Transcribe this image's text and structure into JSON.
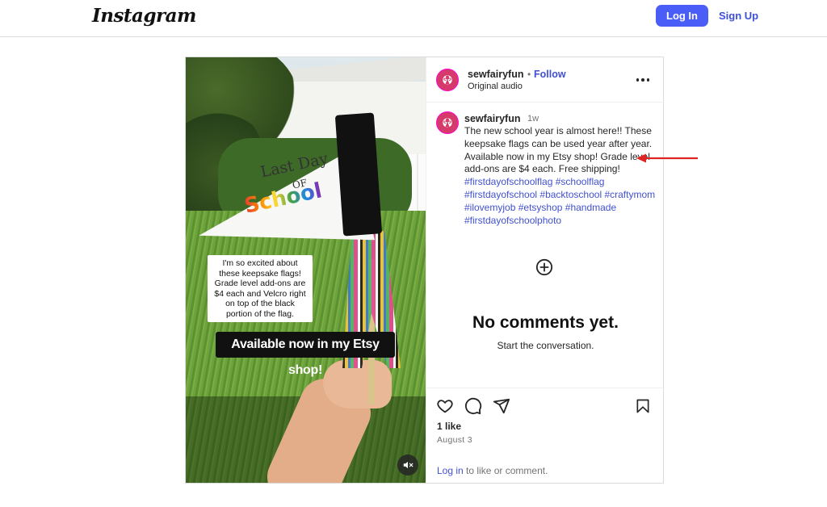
{
  "header": {
    "logo_text": "Instagram",
    "login_label": "Log In",
    "signup_label": "Sign Up"
  },
  "post": {
    "username": "sewfairyfun",
    "separator": "•",
    "follow_label": "Follow",
    "audio": "Original audio",
    "media": {
      "pennant_line1": "Last Day",
      "pennant_line2": "OF",
      "pennant_line3": "School",
      "caption_box": "I'm so excited about these keepsake flags! Grade level add-ons are $4 each and Velcro right on top of the black portion of the flag.",
      "caption_banner": "Available now in my Etsy shop!"
    },
    "caption": {
      "username": "sewfairyfun",
      "time": "1w",
      "text": "The new school year is almost here!! These keepsake flags can be used year after year. Available now in my Etsy shop! Grade level add-ons are $4 each. Free shipping!",
      "hashtags": [
        "#firstdayofschoolflag",
        "#schoolflag",
        "#firstdayofschool",
        "#backtoschool",
        "#craftymom",
        "#ilovemyjob",
        "#etsyshop",
        "#handmade",
        "#firstdayofschoolphoto"
      ]
    },
    "comments": {
      "empty_title": "No comments yet.",
      "empty_sub": "Start the conversation."
    },
    "likes": "1 like",
    "date": "August 3",
    "login_prompt": {
      "link": "Log in",
      "rest": " to like or comment."
    }
  },
  "icons": {
    "more": "more-options-icon",
    "add": "add-comment-icon",
    "like": "heart-icon",
    "comment": "comment-icon",
    "share": "share-icon",
    "save": "bookmark-icon",
    "mute": "muted-speaker-icon",
    "annotation": "red-arrow-icon"
  },
  "colors": {
    "accent": "#4a5df7",
    "link": "#4150cf",
    "annotation": "#e02424"
  }
}
